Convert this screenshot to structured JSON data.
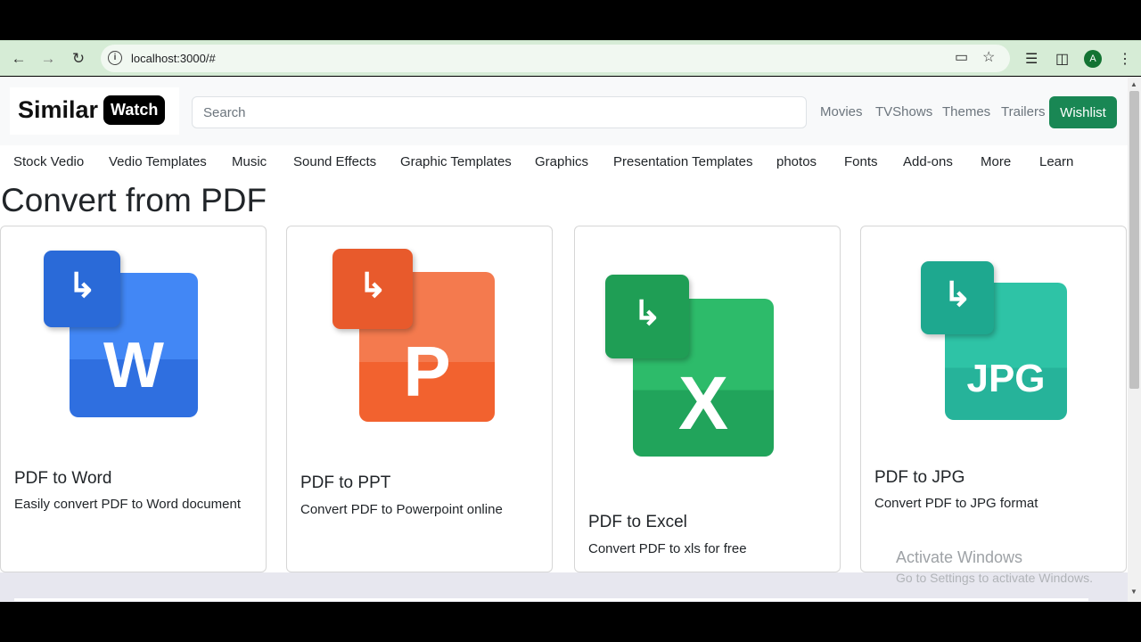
{
  "browser": {
    "url": "localhost:3000/#",
    "avatar_letter": "A",
    "icons": [
      "back-icon",
      "forward-icon",
      "reload-icon",
      "site-info-icon",
      "install-app-icon",
      "bookmark-star-icon",
      "media-queue-icon",
      "side-panel-icon",
      "menu-kebab-icon"
    ]
  },
  "header": {
    "logo_word1": "Similar",
    "logo_word2": "Watch",
    "search_placeholder": "Search",
    "links": [
      "Movies",
      "TVShows",
      "Themes",
      "Trailers"
    ],
    "wishlist_label": "Wishlist"
  },
  "categories": [
    "Stock Vedio",
    "Vedio Templates",
    "Music",
    "Sound Effects",
    "Graphic Templates",
    "Graphics",
    "Presentation Templates",
    "photos",
    "Fonts",
    "Add-ons",
    "More",
    "Learn"
  ],
  "page_title": "Convert from PDF",
  "cards": [
    {
      "title": "PDF to Word",
      "text": "Easily convert PDF to Word document",
      "icon_letter": "W",
      "icon": "word-convert-icon"
    },
    {
      "title": "PDF to PPT",
      "text": "Convert PDF to Powerpoint online",
      "icon_letter": "P",
      "icon": "ppt-convert-icon"
    },
    {
      "title": "PDF to Excel",
      "text": "Convert PDF to xls for free",
      "icon_letter": "X",
      "icon": "excel-convert-icon"
    },
    {
      "title": "PDF to JPG",
      "text": "Convert PDF to JPG format",
      "icon_letter": "JPG",
      "icon": "jpg-convert-icon"
    }
  ],
  "watermark": {
    "line1": "Activate Windows",
    "line2": "Go to Settings to activate Windows."
  },
  "colors": {
    "word": "#3b82f6",
    "ppt": "#f4683b",
    "excel": "#22a55c",
    "jpg": "#26b39a",
    "wishlist": "#198754"
  }
}
